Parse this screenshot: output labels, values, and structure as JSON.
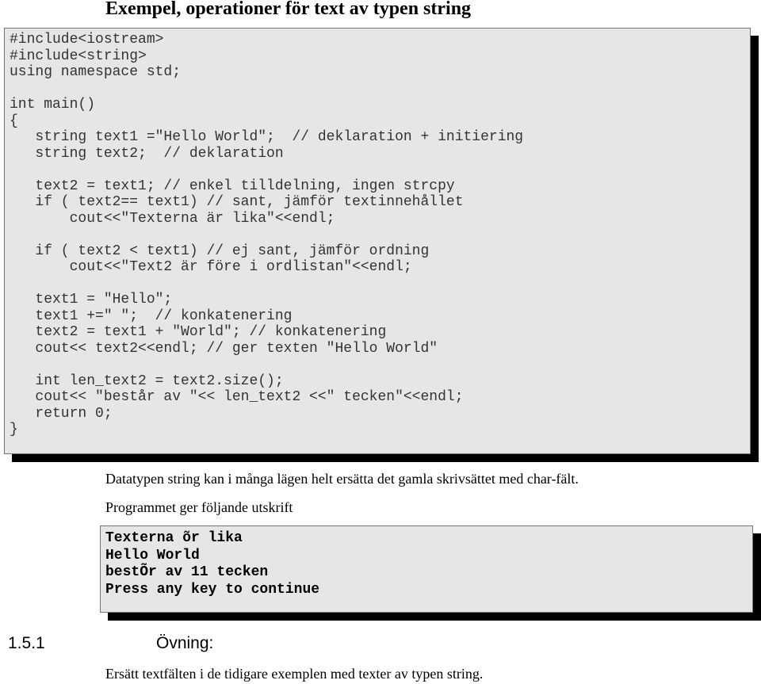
{
  "title": "Exempel, operationer för text av typen string",
  "code": "#include<iostream>\n#include<string>\nusing namespace std;\n\nint main()\n{\n   string text1 =\"Hello World\";  // deklaration + initiering\n   string text2;  // deklaration\n\n   text2 = text1; // enkel tilldelning, ingen strcpy\n   if ( text2== text1) // sant, jämför textinnehållet\n       cout<<\"Texterna är lika\"<<endl;\n\n   if ( text2 < text1) // ej sant, jämför ordning\n       cout<<\"Text2 är före i ordlistan\"<<endl;\n\n   text1 = \"Hello\";\n   text1 +=\" \";  // konkatenering\n   text2 = text1 + \"World\"; // konkatenering\n   cout<< text2<<endl; // ger texten \"Hello World\"\n\n   int len_text2 = text2.size();\n   cout<< \"består av \"<< len_text2 <<\" tecken\"<<endl;\n   return 0;\n}",
  "paragraph1": "Datatypen string kan i många lägen helt ersätta det gamla skrivsättet med char-fält.",
  "paragraph2": "Programmet ger följande utskrift",
  "output": "Texterna õr lika\nHello World\nbestÕr av 11 tecken\nPress any key to continue",
  "section": {
    "number": "1.5.1",
    "title": "Övning:"
  },
  "exercise": "Ersätt textfälten i de tidigare exemplen med texter av typen string."
}
